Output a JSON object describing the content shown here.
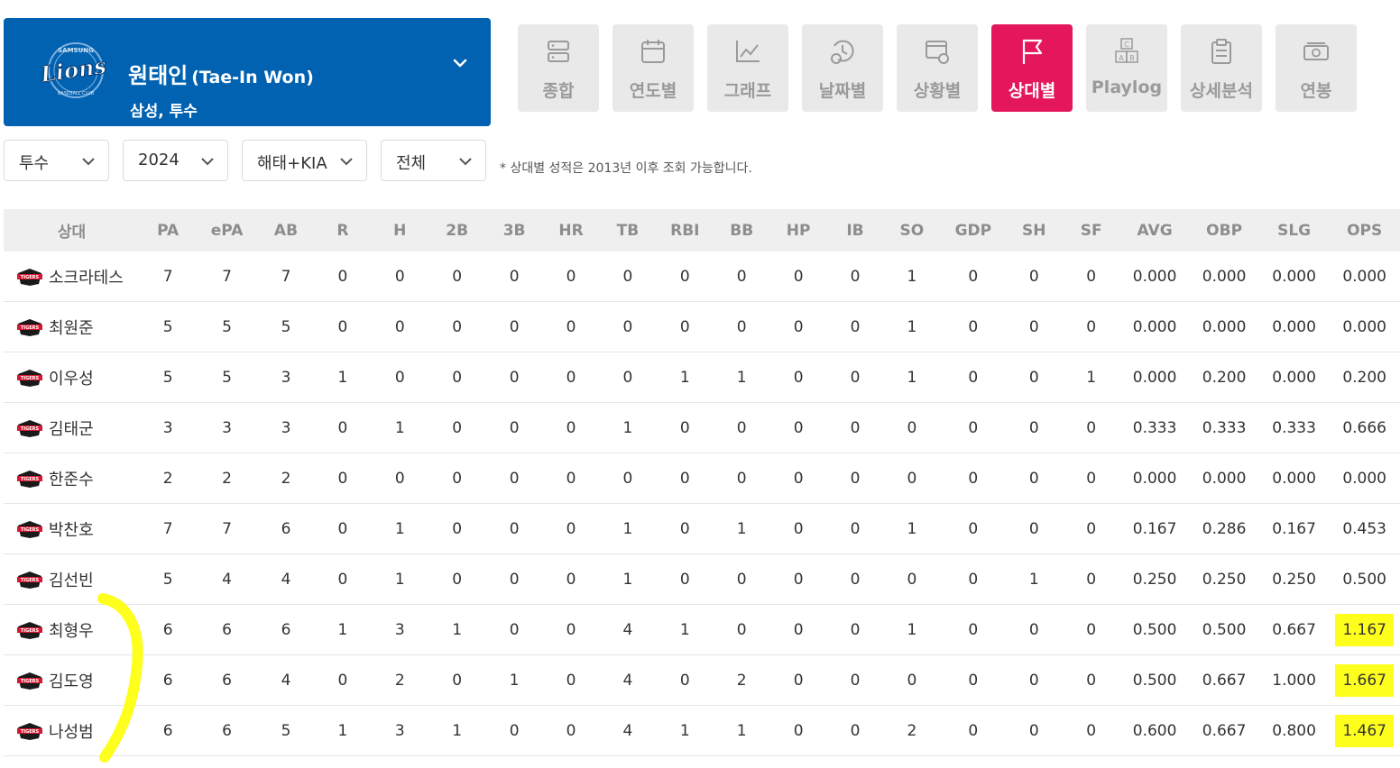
{
  "player": {
    "name_ko": "원태인",
    "name_en": "(Tae-In Won)",
    "team_position": "삼성, 투수",
    "logo_text": "Lions",
    "logo_arc_top": "SAMSUNG",
    "logo_arc_bottom": "BASEBALL CLUB"
  },
  "tabs": [
    {
      "label": "종합",
      "icon": "server-icon"
    },
    {
      "label": "연도별",
      "icon": "calendar-icon"
    },
    {
      "label": "그래프",
      "icon": "line-chart-icon"
    },
    {
      "label": "날짜별",
      "icon": "date-clock-icon"
    },
    {
      "label": "상황별",
      "icon": "situation-settings-icon"
    },
    {
      "label": "상대별",
      "icon": "flag-icon",
      "active": true
    },
    {
      "label": "Playlog",
      "icon": "abc-icon"
    },
    {
      "label": "상세분석",
      "icon": "clipboard-icon"
    },
    {
      "label": "연봉",
      "icon": "money-icon"
    }
  ],
  "filters": {
    "position": "투수",
    "year": "2024",
    "team": "해태+KIA",
    "scope": "전체"
  },
  "note": "* 상대별 성적은 2013년 이후 조회 가능합니다.",
  "table": {
    "columns": [
      "상대",
      "PA",
      "ePA",
      "AB",
      "R",
      "H",
      "2B",
      "3B",
      "HR",
      "TB",
      "RBI",
      "BB",
      "HP",
      "IB",
      "SO",
      "GDP",
      "SH",
      "SF",
      "AVG",
      "OBP",
      "SLG",
      "OPS"
    ],
    "team_logo_text": "TIGERS",
    "rows": [
      {
        "name": "소크라테스",
        "stats": [
          "7",
          "7",
          "7",
          "0",
          "0",
          "0",
          "0",
          "0",
          "0",
          "0",
          "0",
          "0",
          "0",
          "1",
          "0",
          "0",
          "0",
          "0.000",
          "0.000",
          "0.000",
          "0.000"
        ]
      },
      {
        "name": "최원준",
        "stats": [
          "5",
          "5",
          "5",
          "0",
          "0",
          "0",
          "0",
          "0",
          "0",
          "0",
          "0",
          "0",
          "0",
          "1",
          "0",
          "0",
          "0",
          "0.000",
          "0.000",
          "0.000",
          "0.000"
        ]
      },
      {
        "name": "이우성",
        "stats": [
          "5",
          "5",
          "3",
          "1",
          "0",
          "0",
          "0",
          "0",
          "0",
          "1",
          "1",
          "0",
          "0",
          "1",
          "0",
          "0",
          "1",
          "0.000",
          "0.200",
          "0.000",
          "0.200"
        ]
      },
      {
        "name": "김태군",
        "stats": [
          "3",
          "3",
          "3",
          "0",
          "1",
          "0",
          "0",
          "0",
          "1",
          "0",
          "0",
          "0",
          "0",
          "0",
          "0",
          "0",
          "0",
          "0.333",
          "0.333",
          "0.333",
          "0.666"
        ]
      },
      {
        "name": "한준수",
        "stats": [
          "2",
          "2",
          "2",
          "0",
          "0",
          "0",
          "0",
          "0",
          "0",
          "0",
          "0",
          "0",
          "0",
          "0",
          "0",
          "0",
          "0",
          "0.000",
          "0.000",
          "0.000",
          "0.000"
        ]
      },
      {
        "name": "박찬호",
        "stats": [
          "7",
          "7",
          "6",
          "0",
          "1",
          "0",
          "0",
          "0",
          "1",
          "0",
          "1",
          "0",
          "0",
          "1",
          "0",
          "0",
          "0",
          "0.167",
          "0.286",
          "0.167",
          "0.453"
        ]
      },
      {
        "name": "김선빈",
        "stats": [
          "5",
          "4",
          "4",
          "0",
          "1",
          "0",
          "0",
          "0",
          "1",
          "0",
          "0",
          "0",
          "0",
          "0",
          "0",
          "1",
          "0",
          "0.250",
          "0.250",
          "0.250",
          "0.500"
        ]
      },
      {
        "name": "최형우",
        "stats": [
          "6",
          "6",
          "6",
          "1",
          "3",
          "1",
          "0",
          "0",
          "4",
          "1",
          "0",
          "0",
          "0",
          "1",
          "0",
          "0",
          "0",
          "0.500",
          "0.500",
          "0.667",
          "1.167"
        ],
        "highlight": true
      },
      {
        "name": "김도영",
        "stats": [
          "6",
          "6",
          "4",
          "0",
          "2",
          "0",
          "1",
          "0",
          "4",
          "0",
          "2",
          "0",
          "0",
          "0",
          "0",
          "0",
          "0",
          "0.500",
          "0.667",
          "1.000",
          "1.667"
        ],
        "highlight": true
      },
      {
        "name": "나성범",
        "stats": [
          "6",
          "6",
          "5",
          "1",
          "3",
          "1",
          "0",
          "0",
          "4",
          "1",
          "1",
          "0",
          "0",
          "2",
          "0",
          "0",
          "0",
          "0.600",
          "0.667",
          "0.800",
          "1.467"
        ],
        "highlight": true
      }
    ]
  },
  "colors": {
    "profile_bg": "#0062b1",
    "active_tab": "#e4175c",
    "tab_bg": "#e9e9e9",
    "highlight": "#ffff1e"
  }
}
